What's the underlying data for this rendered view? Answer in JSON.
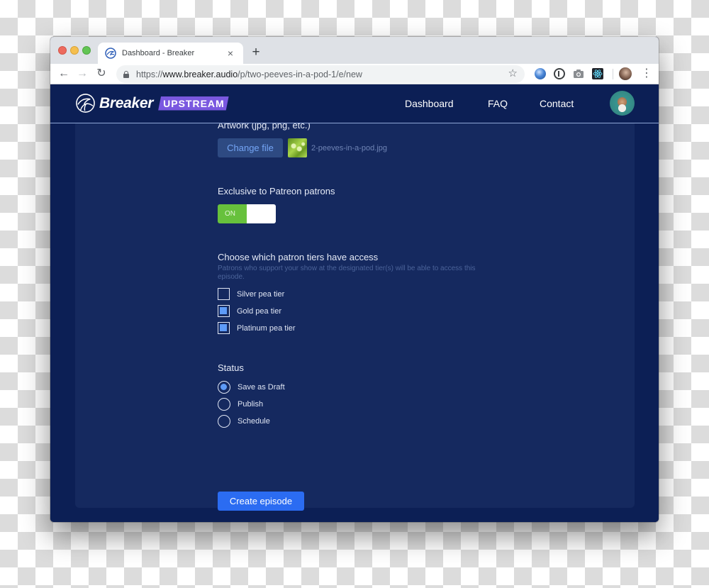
{
  "browser": {
    "tab": {
      "title": "Dashboard - Breaker",
      "close_glyph": "×"
    },
    "new_tab_glyph": "+",
    "nav": {
      "back_glyph": "←",
      "forward_glyph": "→",
      "reload_glyph": "↻"
    },
    "address": {
      "scheme": "https://",
      "host": "www.breaker.audio",
      "path": "/p/two-peeves-in-a-pod-1/e/new"
    },
    "bookmark_glyph": "☆",
    "extensions": [
      "globe-extension",
      "1password-extension",
      "camera-extension",
      "react-devtools-extension"
    ],
    "menu_glyph": "⋮"
  },
  "site": {
    "brand": "Breaker",
    "badge": "UPSTREAM",
    "nav": [
      "Dashboard",
      "FAQ",
      "Contact"
    ],
    "colors": {
      "header_bg": "#0c1f55",
      "card_bg": "#15295f",
      "accent": "#2b6cf2",
      "badge": "#7a58e0",
      "toggle_on": "#67c13c"
    }
  },
  "form": {
    "artwork": {
      "label": "Artwork (jpg, png, etc.)",
      "button": "Change file",
      "file_name": "2-peeves-in-a-pod.jpg"
    },
    "exclusive": {
      "label": "Exclusive to Patreon patrons",
      "toggle_state": "ON"
    },
    "tiers": {
      "label": "Choose which patron tiers have access",
      "help": "Patrons who support your show at the designated tier(s) will be able to access this episode.",
      "options": [
        {
          "label": "Silver pea tier",
          "checked": false
        },
        {
          "label": "Gold pea tier",
          "checked": true
        },
        {
          "label": "Platinum pea tier",
          "checked": true
        }
      ]
    },
    "status": {
      "label": "Status",
      "options": [
        {
          "label": "Save as Draft",
          "selected": true
        },
        {
          "label": "Publish",
          "selected": false
        },
        {
          "label": "Schedule",
          "selected": false
        }
      ]
    },
    "submit": "Create episode"
  }
}
